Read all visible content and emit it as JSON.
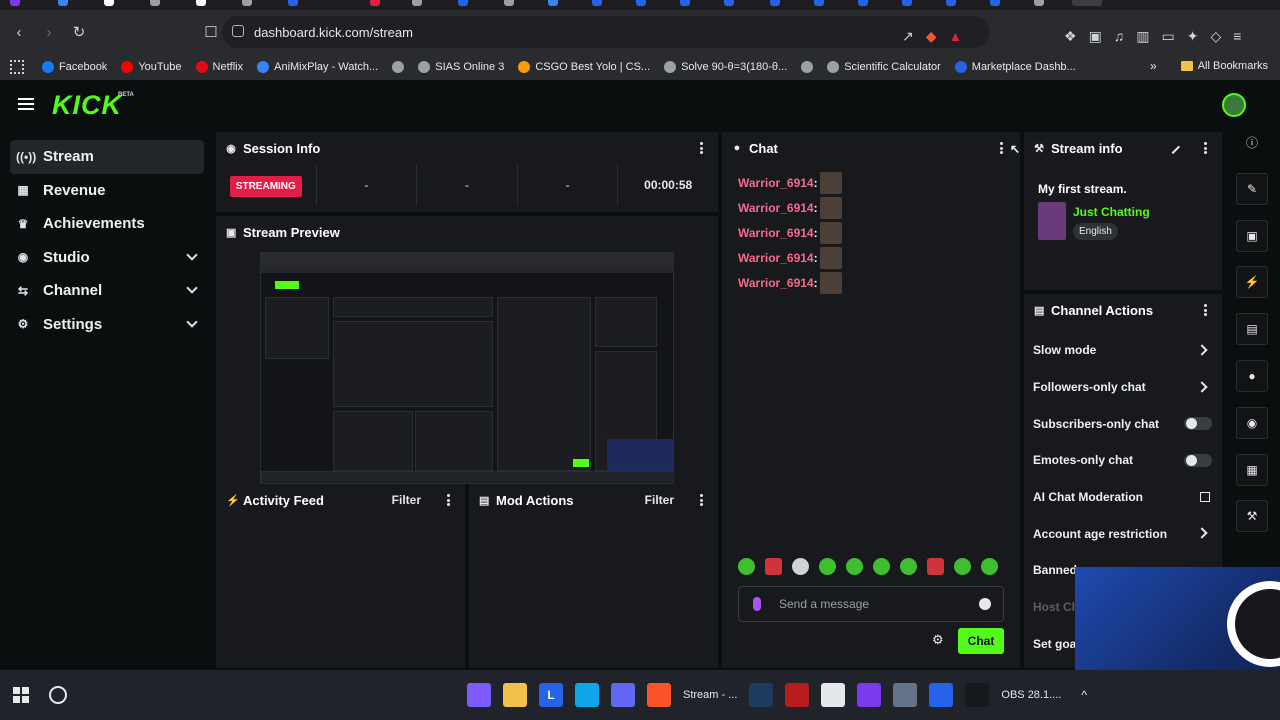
{
  "browser": {
    "url": "dashboard.kick.com/stream",
    "bookmarks": [
      {
        "label": "Facebook",
        "color": "#1877f2"
      },
      {
        "label": "YouTube",
        "color": "#ff0000"
      },
      {
        "label": "Netflix",
        "color": "#e50914"
      },
      {
        "label": "AniMixPlay - Watch...",
        "color": "#3b82f6"
      },
      {
        "label": "",
        "color": "#9aa0a6"
      },
      {
        "label": "SIAS Online 3",
        "color": "#9aa0a6"
      },
      {
        "label": "CSGO Best Yolo | CS...",
        "color": "#f59e0b"
      },
      {
        "label": "Solve 90-θ=3(180-θ...",
        "color": "#9aa0a6"
      },
      {
        "label": "",
        "color": "#9aa0a6"
      },
      {
        "label": "Scientific Calculator",
        "color": "#9aa0a6"
      },
      {
        "label": "Marketplace Dashb...",
        "color": "#2563eb"
      }
    ],
    "all_bookmarks": "All Bookmarks",
    "more": "»"
  },
  "app": {
    "logo": "KICK",
    "beta": "BETA"
  },
  "sidebar": {
    "items": [
      {
        "label": "Stream",
        "icon": "((•))",
        "active": true,
        "expand": false
      },
      {
        "label": "Revenue",
        "icon": "▦",
        "active": false,
        "expand": false
      },
      {
        "label": "Achievements",
        "icon": "♛",
        "active": false,
        "expand": false
      },
      {
        "label": "Studio",
        "icon": "◉",
        "active": false,
        "expand": true
      },
      {
        "label": "Channel",
        "icon": "⇆",
        "active": false,
        "expand": true
      },
      {
        "label": "Settings",
        "icon": "⚙",
        "active": false,
        "expand": true
      }
    ]
  },
  "session": {
    "title": "Session Info",
    "status": "STREAMING",
    "cells": [
      "-",
      "-",
      "-"
    ],
    "duration": "00:00:58"
  },
  "preview": {
    "title": "Stream Preview"
  },
  "activity": {
    "title": "Activity Feed",
    "filter": "Filter"
  },
  "mod": {
    "title": "Mod Actions",
    "filter": "Filter"
  },
  "chat": {
    "title": "Chat",
    "messages": [
      {
        "user": "Warrior_6914",
        "colon": ":"
      },
      {
        "user": "Warrior_6914",
        "colon": ":"
      },
      {
        "user": "Warrior_6914",
        "colon": ":"
      },
      {
        "user": "Warrior_6914",
        "colon": ":"
      },
      {
        "user": "Warrior_6914",
        "colon": ":"
      }
    ],
    "placeholder": "Send a message",
    "send_label": "Chat"
  },
  "stream_info": {
    "title": "Stream info",
    "stream_title": "My first stream.",
    "category": "Just Chatting",
    "language": "English"
  },
  "channel_actions": {
    "title": "Channel Actions",
    "items": [
      {
        "label": "Slow mode",
        "control": "arrow"
      },
      {
        "label": "Followers-only chat",
        "control": "arrow"
      },
      {
        "label": "Subscribers-only chat",
        "control": "toggle"
      },
      {
        "label": "Emotes-only chat",
        "control": "toggle"
      },
      {
        "label": "AI Chat Moderation",
        "control": "external"
      },
      {
        "label": "Account age restriction",
        "control": "arrow"
      },
      {
        "label": "Banned",
        "control": "none"
      },
      {
        "label": "Host Ch",
        "control": "none"
      },
      {
        "label": "Set goa",
        "control": "none"
      }
    ]
  },
  "taskbar": {
    "apps": [
      {
        "label": "",
        "color": "#7c5cff"
      },
      {
        "label": "",
        "color": "#f2c14a"
      },
      {
        "label": "L",
        "color": "#2563eb"
      },
      {
        "label": "",
        "color": "#0ea5e9"
      },
      {
        "label": "",
        "color": "#6366f1"
      },
      {
        "label": "Stream - ...",
        "color": "#fb542b"
      },
      {
        "label": "",
        "color": "#1e3a5f"
      },
      {
        "label": "",
        "color": "#b91c1c"
      },
      {
        "label": "",
        "color": "#e5e7eb"
      },
      {
        "label": "",
        "color": "#7c3aed"
      },
      {
        "label": "",
        "color": "#64748b"
      },
      {
        "label": "",
        "color": "#2563eb"
      },
      {
        "label": "OBS 28.1....",
        "color": "#16181c"
      }
    ],
    "tray": "^"
  }
}
